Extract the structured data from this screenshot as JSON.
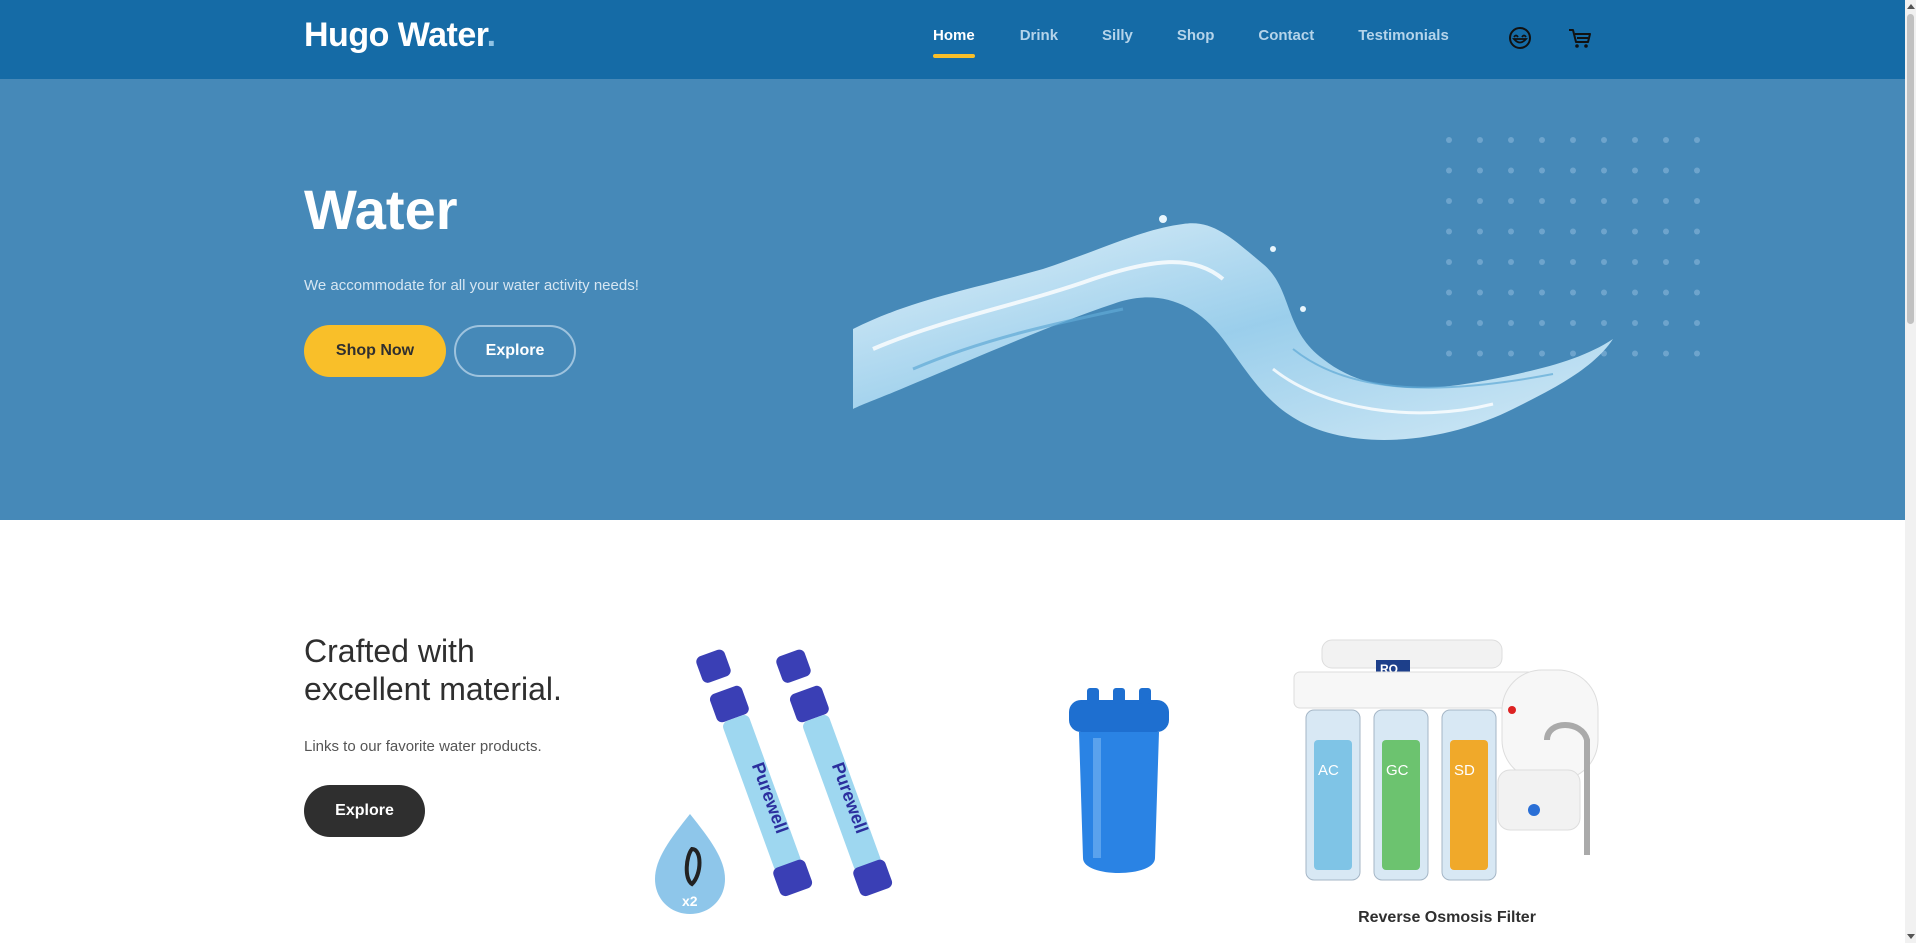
{
  "header": {
    "logo_text": "Hugo Water",
    "logo_dot": ".",
    "nav": [
      {
        "label": "Home",
        "active": true
      },
      {
        "label": "Drink",
        "active": false
      },
      {
        "label": "Silly",
        "active": false
      },
      {
        "label": "Shop",
        "active": false
      },
      {
        "label": "Contact",
        "active": false
      },
      {
        "label": "Testimonials",
        "active": false
      }
    ],
    "icons": [
      "profile-icon",
      "cart-icon"
    ]
  },
  "hero": {
    "title": "Water",
    "subtitle": "We accommodate for all your water activity needs!",
    "primary_button": "Shop Now",
    "secondary_button": "Explore"
  },
  "products": {
    "title": "Crafted with excellent material.",
    "subtitle": "Links to our favorite water products.",
    "button": "Explore",
    "items": [
      {
        "brand": "Purewell",
        "badge": "x2"
      },
      {
        "name": ""
      },
      {
        "name": "Reverse Osmosis Filter",
        "filters": [
          "AC",
          "GC",
          "SD"
        ],
        "tag": "RO"
      }
    ]
  },
  "colors": {
    "header": "#156ba6",
    "hero": "#4689b8",
    "accent": "#f9bf29",
    "dark": "#2f2f2f"
  }
}
